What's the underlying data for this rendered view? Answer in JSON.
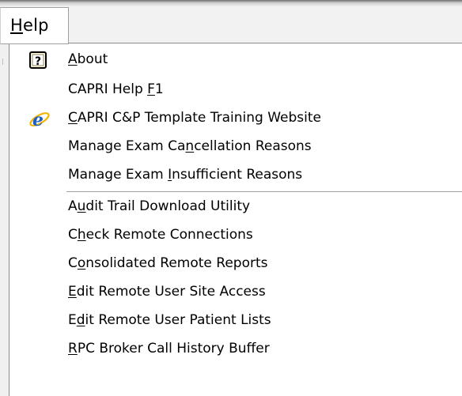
{
  "menubar": {
    "help_label": "Help",
    "help_mnemonic": "H"
  },
  "menu": {
    "items": [
      {
        "pre": "",
        "mn": "A",
        "post": "bout",
        "icon": "help-question-icon"
      },
      {
        "pre": "CAPRI Help ",
        "mn": "F",
        "post": "1",
        "icon": ""
      },
      {
        "pre": "",
        "mn": "C",
        "post": "APRI C&P Template Training Website",
        "icon": "internet-explorer-icon"
      },
      {
        "pre": "Manage Exam Ca",
        "mn": "n",
        "post": "cellation Reasons",
        "icon": ""
      },
      {
        "pre": "Manage Exam ",
        "mn": "I",
        "post": "nsufficient Reasons",
        "icon": ""
      },
      {
        "pre": "A",
        "mn": "u",
        "post": "dit Trail Download Utility",
        "icon": ""
      },
      {
        "pre": "C",
        "mn": "h",
        "post": "eck Remote Connections",
        "icon": ""
      },
      {
        "pre": "C",
        "mn": "o",
        "post": "nsolidated Remote Reports",
        "icon": ""
      },
      {
        "pre": "",
        "mn": "E",
        "post": "dit Remote User Site Access",
        "icon": ""
      },
      {
        "pre": "E",
        "mn": "d",
        "post": "it Remote User Patient Lists",
        "icon": ""
      },
      {
        "pre": "",
        "mn": "R",
        "post": "PC Broker Call History Buffer",
        "icon": ""
      }
    ]
  }
}
